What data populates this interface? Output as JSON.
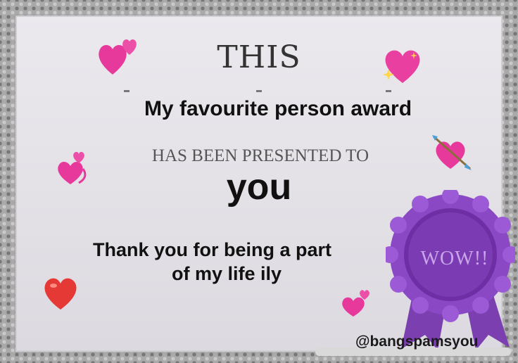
{
  "certificate": {
    "heading": "THIS",
    "award_title": "My favourite person award",
    "presented_text": "HAS BEEN PRESENTED TO",
    "recipient": "you",
    "message_line1": "Thank you for being a part",
    "message_line2": "of my life ily",
    "rosette_text": "WOW!!",
    "watermark": "@bangspamsyou"
  },
  "colors": {
    "accent_purple": "#7b3fb0",
    "heart_pink": "#e6399b",
    "heart_red": "#e53935"
  },
  "icons": [
    "heart-icon",
    "sparkling-heart-icon",
    "two-hearts-icon",
    "heart-with-arrow-icon",
    "revolving-hearts-icon",
    "red-heart-icon",
    "rosette-icon"
  ]
}
